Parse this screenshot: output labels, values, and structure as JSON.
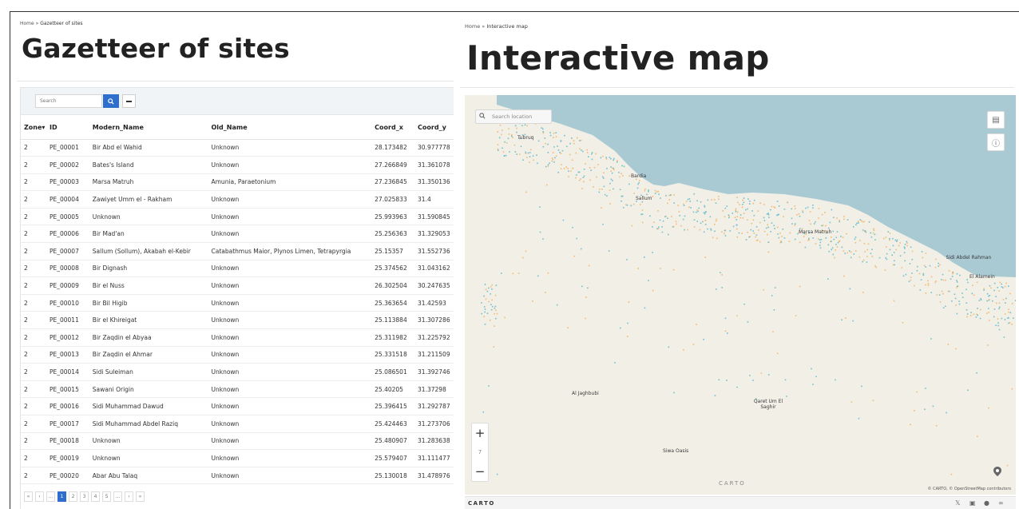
{
  "gazetteer": {
    "breadcrumb_home": "Home",
    "breadcrumb_sep": "»",
    "breadcrumb_current": "Gazetteer of sites",
    "title": "Gazetteer of sites",
    "search_placeholder": "Search",
    "columns": [
      "Zone",
      "ID",
      "Modern_Name",
      "Old_Name",
      "Coord_x",
      "Coord_y"
    ],
    "rows": [
      [
        "2",
        "PE_00001",
        "Bir Abd el Wahid",
        "Unknown",
        "28.173482",
        "30.977778"
      ],
      [
        "2",
        "PE_00002",
        "Bates's Island",
        "Unknown",
        "27.266849",
        "31.361078"
      ],
      [
        "2",
        "PE_00003",
        "Marsa Matruh",
        "Amunia, Paraetonium",
        "27.236845",
        "31.350136"
      ],
      [
        "2",
        "PE_00004",
        "Zawiyet Umm el - Rakham",
        "Unknown",
        "27.025833",
        "31.4"
      ],
      [
        "2",
        "PE_00005",
        "Unknown",
        "Unknown",
        "25.993963",
        "31.590845"
      ],
      [
        "2",
        "PE_00006",
        "Bir Mad'an",
        "Unknown",
        "25.256363",
        "31.329053"
      ],
      [
        "2",
        "PE_00007",
        "Sallum (Sollum), Akabah el-Kebir",
        "Catabathmus Maior, Plynos Limen, Tetrapyrgia",
        "25.15357",
        "31.552736"
      ],
      [
        "2",
        "PE_00008",
        "Bir Dignash",
        "Unknown",
        "25.374562",
        "31.043162"
      ],
      [
        "2",
        "PE_00009",
        "Bir el Nuss",
        "Unknown",
        "26.302504",
        "30.247635"
      ],
      [
        "2",
        "PE_00010",
        "Bir Bil Higib",
        "Unknown",
        "25.363654",
        "31.42593"
      ],
      [
        "2",
        "PE_00011",
        "Bir el Khireigat",
        "Unknown",
        "25.113884",
        "31.307286"
      ],
      [
        "2",
        "PE_00012",
        "Bir Zaqdin el Abyaa",
        "Unknown",
        "25.311982",
        "31.225792"
      ],
      [
        "2",
        "PE_00013",
        "Bir Zaqdin el Ahmar",
        "Unknown",
        "25.331518",
        "31.211509"
      ],
      [
        "2",
        "PE_00014",
        "Sidi Suleiman",
        "Unknown",
        "25.086501",
        "31.392746"
      ],
      [
        "2",
        "PE_00015",
        "Sawani Origin",
        "Unknown",
        "25.40205",
        "31.37298"
      ],
      [
        "2",
        "PE_00016",
        "Sidi Muhammad Dawud",
        "Unknown",
        "25.396415",
        "31.292787"
      ],
      [
        "2",
        "PE_00017",
        "Sidi Muhammad Abdel Raziq",
        "Unknown",
        "25.424463",
        "31.273706"
      ],
      [
        "2",
        "PE_00018",
        "Unknown",
        "Unknown",
        "25.480907",
        "31.283638"
      ],
      [
        "2",
        "PE_00019",
        "Unknown",
        "Unknown",
        "25.579407",
        "31.111477"
      ],
      [
        "2",
        "PE_00020",
        "Abar Abu Talaq",
        "Unknown",
        "25.130018",
        "31.478976"
      ]
    ],
    "pager": [
      "«",
      "‹",
      "…",
      "1",
      "2",
      "3",
      "4",
      "5",
      "…",
      "›",
      "»"
    ],
    "active_page": "1"
  },
  "map_page": {
    "breadcrumb_home": "Home",
    "breadcrumb_sep": "»",
    "breadcrumb_current": "Interactive map",
    "title": "Interactive map",
    "search_placeholder": "Search location",
    "zoom_in": "+",
    "zoom_level": "7",
    "zoom_out": "−",
    "places": [
      "Tubruq",
      "Bardia",
      "Sallum",
      "Marsa Matruh",
      "Sidi Abdel Rahman",
      "El Alamein",
      "Al Jaghbubi",
      "Qaret Um El Saghir",
      "Siwa Oasis"
    ],
    "attribution": "© CARTO, © OpenStreetMap contributors",
    "carto_watermark": "CARTO",
    "footer_logo": "CARTO",
    "colors": {
      "sea": "#a9c9d3",
      "land": "#f2efe7",
      "dot_teal": "#5ab8c9",
      "dot_orange": "#f0b35e",
      "accent": "#2e6fce"
    },
    "icons": [
      "layers-icon",
      "info-icon",
      "locate-icon",
      "twitter-icon",
      "linkedin-icon",
      "github-icon",
      "link-icon"
    ]
  }
}
